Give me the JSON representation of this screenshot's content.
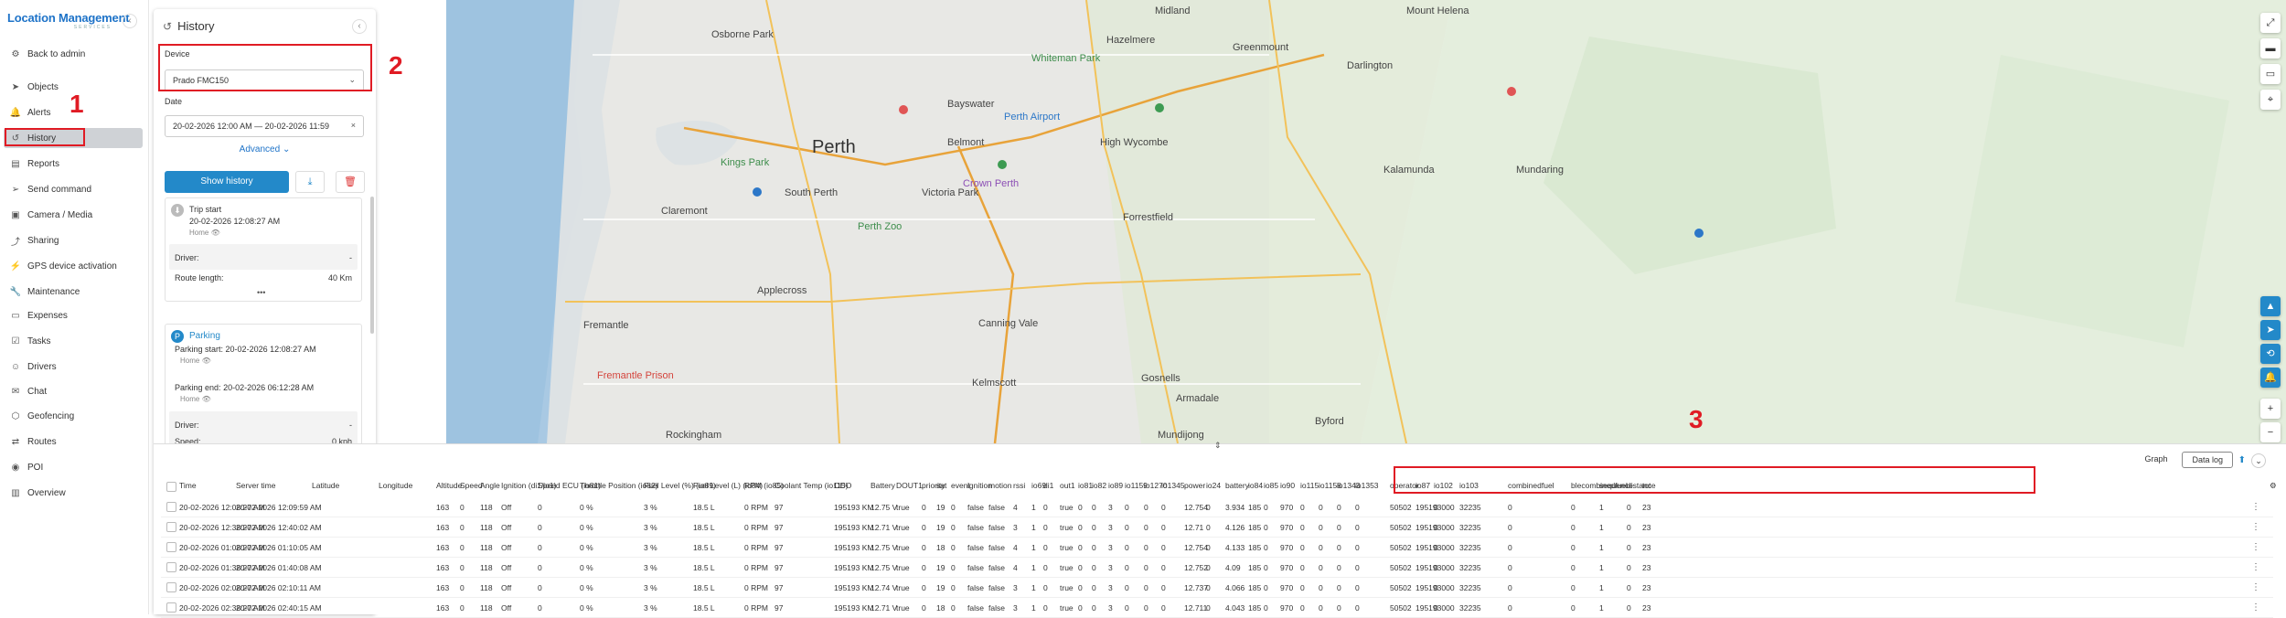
{
  "app": {
    "logo_line1": "Location Management",
    "logo_line2": "SERVICES"
  },
  "sidebar": {
    "items": [
      {
        "label": "Back to admin",
        "icon": "gear-icon",
        "glyph": "⚙"
      },
      {
        "label": "Objects",
        "icon": "navigation-icon",
        "glyph": "➤"
      },
      {
        "label": "Alerts",
        "icon": "bell-icon",
        "glyph": "🔔"
      },
      {
        "label": "History",
        "icon": "history-icon",
        "glyph": "↺"
      },
      {
        "label": "Reports",
        "icon": "reports-icon",
        "glyph": "▤"
      },
      {
        "label": "Send command",
        "icon": "send-icon",
        "glyph": "➢"
      },
      {
        "label": "Camera / Media",
        "icon": "camera-icon",
        "glyph": "▣"
      },
      {
        "label": "Sharing",
        "icon": "share-icon",
        "glyph": "⤴"
      },
      {
        "label": "GPS device activation",
        "icon": "lightning-icon",
        "glyph": "⚡"
      },
      {
        "label": "Maintenance",
        "icon": "wrench-icon",
        "glyph": "🔧"
      },
      {
        "label": "Expenses",
        "icon": "wallet-icon",
        "glyph": "▭"
      },
      {
        "label": "Tasks",
        "icon": "tasks-icon",
        "glyph": "☑"
      },
      {
        "label": "Drivers",
        "icon": "drivers-icon",
        "glyph": "☺"
      },
      {
        "label": "Chat",
        "icon": "chat-icon",
        "glyph": "✉"
      },
      {
        "label": "Geofencing",
        "icon": "geofence-icon",
        "glyph": "⬡"
      },
      {
        "label": "Routes",
        "icon": "route-icon",
        "glyph": "⇄"
      },
      {
        "label": "POI",
        "icon": "pin-icon",
        "glyph": "◉"
      },
      {
        "label": "Overview",
        "icon": "chart-icon",
        "glyph": "▥"
      }
    ],
    "active": "History"
  },
  "panel": {
    "title": "History",
    "device_label": "Device",
    "device_value": "Prado FMC150",
    "date_label": "Date",
    "date_value": "20-02-2026 12:00 AM — 20-02-2026 11:59",
    "advanced": "Advanced",
    "show_history": "Show history",
    "trip": {
      "title": "Trip start",
      "time": "20-02-2026 12:08:27 AM",
      "place": "Home",
      "driver_label": "Driver:",
      "driver_value": "-",
      "route_label": "Route length:",
      "route_value": "40 Km",
      "more": "•••"
    },
    "parking": {
      "title": "Parking",
      "start_label": "Parking start:",
      "start_value": "20-02-2026 12:08:27 AM",
      "start_place": "Home",
      "end_label": "Parking end:",
      "end_value": "20-02-2026 06:12:28 AM",
      "end_place": "Home",
      "driver_label": "Driver:",
      "driver_value": "-",
      "speed_label": "Speed:",
      "speed_value": "0 kph"
    }
  },
  "annotations": [
    "1",
    "2",
    "3"
  ],
  "map": {
    "labels": [
      {
        "t": "Perth",
        "c": "big"
      },
      {
        "t": "Midland",
        "c": ""
      },
      {
        "t": "Osborne Park",
        "c": ""
      },
      {
        "t": "Bayswater",
        "c": ""
      },
      {
        "t": "Hazelmere",
        "c": ""
      },
      {
        "t": "Greenmount",
        "c": ""
      },
      {
        "t": "Darlington",
        "c": ""
      },
      {
        "t": "Belmont",
        "c": ""
      },
      {
        "t": "High Wycombe",
        "c": ""
      },
      {
        "t": "Kalamunda",
        "c": ""
      },
      {
        "t": "South Perth",
        "c": ""
      },
      {
        "t": "Victoria Park",
        "c": ""
      },
      {
        "t": "Claremont",
        "c": ""
      },
      {
        "t": "Forrestfield",
        "c": ""
      },
      {
        "t": "Applecross",
        "c": ""
      },
      {
        "t": "Canning Vale",
        "c": ""
      },
      {
        "t": "Kelmscott",
        "c": ""
      },
      {
        "t": "Armadale",
        "c": ""
      },
      {
        "t": "Fremantle",
        "c": ""
      },
      {
        "t": "Mundaring",
        "c": ""
      },
      {
        "t": "Mount Helena",
        "c": ""
      },
      {
        "t": "Mundijong",
        "c": ""
      },
      {
        "t": "Rockingham",
        "c": ""
      },
      {
        "t": "Gosnells",
        "c": ""
      },
      {
        "t": "Byford",
        "c": ""
      },
      {
        "t": "Perth Airport",
        "c": "blue"
      },
      {
        "t": "Kings Park",
        "c": "green"
      },
      {
        "t": "Whiteman Park",
        "c": "green"
      },
      {
        "t": "Perth Zoo",
        "c": "green"
      },
      {
        "t": "Crown Perth",
        "c": "purple"
      },
      {
        "t": "Fremantle Prison",
        "c": "red"
      }
    ]
  },
  "table": {
    "tabs": [
      "Graph",
      "Data log"
    ],
    "active_tab": "Data log",
    "columns": [
      "Time",
      "Server time",
      "Latitude",
      "Longitude",
      "Altitude",
      "Speed",
      "Angle",
      "Ignition (di1/io1)",
      "Speed ECU (io81)",
      "Throttle Position (io82)",
      "Fuel Level (%) (io89)",
      "Fuel Level (L) (io84)",
      "RPM (io85)",
      "Coolant Temp (io115)",
      "ODO",
      "Battery",
      "DOUT1",
      "priority",
      "sat",
      "event",
      "ignition",
      "motion",
      "rssi",
      "io69",
      "di1",
      "out1",
      "io81",
      "io82",
      "io89",
      "io1159",
      "io1270",
      "io1345",
      "power",
      "io24",
      "battery",
      "io84",
      "io85",
      "io90",
      "io115",
      "io1158",
      "io1343",
      "io1353",
      "operator",
      "io87",
      "io102",
      "io103",
      "combinedfuel",
      "blecombinedfuel",
      "sequence",
      "distance",
      "tot"
    ],
    "rows": [
      [
        "20-02-2026 12:08:27 AM",
        "20-02-2026 12:09:59 AM",
        "",
        "",
        "163",
        "0",
        "118",
        "Off",
        "0",
        "0 %",
        "3 %",
        "18.5 L",
        "0 RPM",
        "97",
        "195193 KM",
        "12.75 V",
        "true",
        "0",
        "19",
        "0",
        "false",
        "false",
        "4",
        "1",
        "0",
        "true",
        "0",
        "0",
        "3",
        "0",
        "0",
        "0",
        "12.754",
        "0",
        "3.934",
        "185",
        "0",
        "970",
        "0",
        "0",
        "0",
        "0",
        "50502",
        "195193000",
        "0",
        "32235",
        "0",
        "0",
        "1",
        "0",
        "23"
      ],
      [
        "20-02-2026 12:38:27 AM",
        "20-02-2026 12:40:02 AM",
        "",
        "",
        "163",
        "0",
        "118",
        "Off",
        "0",
        "0 %",
        "3 %",
        "18.5 L",
        "0 RPM",
        "97",
        "195193 KM",
        "12.71 V",
        "true",
        "0",
        "19",
        "0",
        "false",
        "false",
        "3",
        "1",
        "0",
        "true",
        "0",
        "0",
        "3",
        "0",
        "0",
        "0",
        "12.71",
        "0",
        "4.126",
        "185",
        "0",
        "970",
        "0",
        "0",
        "0",
        "0",
        "50502",
        "195193000",
        "0",
        "32235",
        "0",
        "0",
        "1",
        "0",
        "23"
      ],
      [
        "20-02-2026 01:08:27 AM",
        "20-02-2026 01:10:05 AM",
        "",
        "",
        "163",
        "0",
        "118",
        "Off",
        "0",
        "0 %",
        "3 %",
        "18.5 L",
        "0 RPM",
        "97",
        "195193 KM",
        "12.75 V",
        "true",
        "0",
        "18",
        "0",
        "false",
        "false",
        "4",
        "1",
        "0",
        "true",
        "0",
        "0",
        "3",
        "0",
        "0",
        "0",
        "12.754",
        "0",
        "4.133",
        "185",
        "0",
        "970",
        "0",
        "0",
        "0",
        "0",
        "50502",
        "195193000",
        "0",
        "32235",
        "0",
        "0",
        "1",
        "0",
        "23"
      ],
      [
        "20-02-2026 01:38:27 AM",
        "20-02-2026 01:40:08 AM",
        "",
        "",
        "163",
        "0",
        "118",
        "Off",
        "0",
        "0 %",
        "3 %",
        "18.5 L",
        "0 RPM",
        "97",
        "195193 KM",
        "12.75 V",
        "true",
        "0",
        "19",
        "0",
        "false",
        "false",
        "4",
        "1",
        "0",
        "true",
        "0",
        "0",
        "3",
        "0",
        "0",
        "0",
        "12.752",
        "0",
        "4.09",
        "185",
        "0",
        "970",
        "0",
        "0",
        "0",
        "0",
        "50502",
        "195193000",
        "0",
        "32235",
        "0",
        "0",
        "1",
        "0",
        "23"
      ],
      [
        "20-02-2026 02:08:27 AM",
        "20-02-2026 02:10:11 AM",
        "",
        "",
        "163",
        "0",
        "118",
        "Off",
        "0",
        "0 %",
        "3 %",
        "18.5 L",
        "0 RPM",
        "97",
        "195193 KM",
        "12.74 V",
        "true",
        "0",
        "19",
        "0",
        "false",
        "false",
        "3",
        "1",
        "0",
        "true",
        "0",
        "0",
        "3",
        "0",
        "0",
        "0",
        "12.737",
        "0",
        "4.066",
        "185",
        "0",
        "970",
        "0",
        "0",
        "0",
        "0",
        "50502",
        "195193000",
        "0",
        "32235",
        "0",
        "0",
        "1",
        "0",
        "23"
      ],
      [
        "20-02-2026 02:38:27 AM",
        "20-02-2026 02:40:15 AM",
        "",
        "",
        "163",
        "0",
        "118",
        "Off",
        "0",
        "0 %",
        "3 %",
        "18.5 L",
        "0 RPM",
        "97",
        "195193 KM",
        "12.71 V",
        "true",
        "0",
        "18",
        "0",
        "false",
        "false",
        "3",
        "1",
        "0",
        "true",
        "0",
        "0",
        "3",
        "0",
        "0",
        "0",
        "12.711",
        "0",
        "4.043",
        "185",
        "0",
        "970",
        "0",
        "0",
        "0",
        "0",
        "50502",
        "195193000",
        "0",
        "32235",
        "0",
        "0",
        "1",
        "0",
        "23"
      ]
    ]
  },
  "colors": {
    "accent": "#2389c9",
    "annotation": "#e01b24",
    "brand": "#1e73c8"
  }
}
